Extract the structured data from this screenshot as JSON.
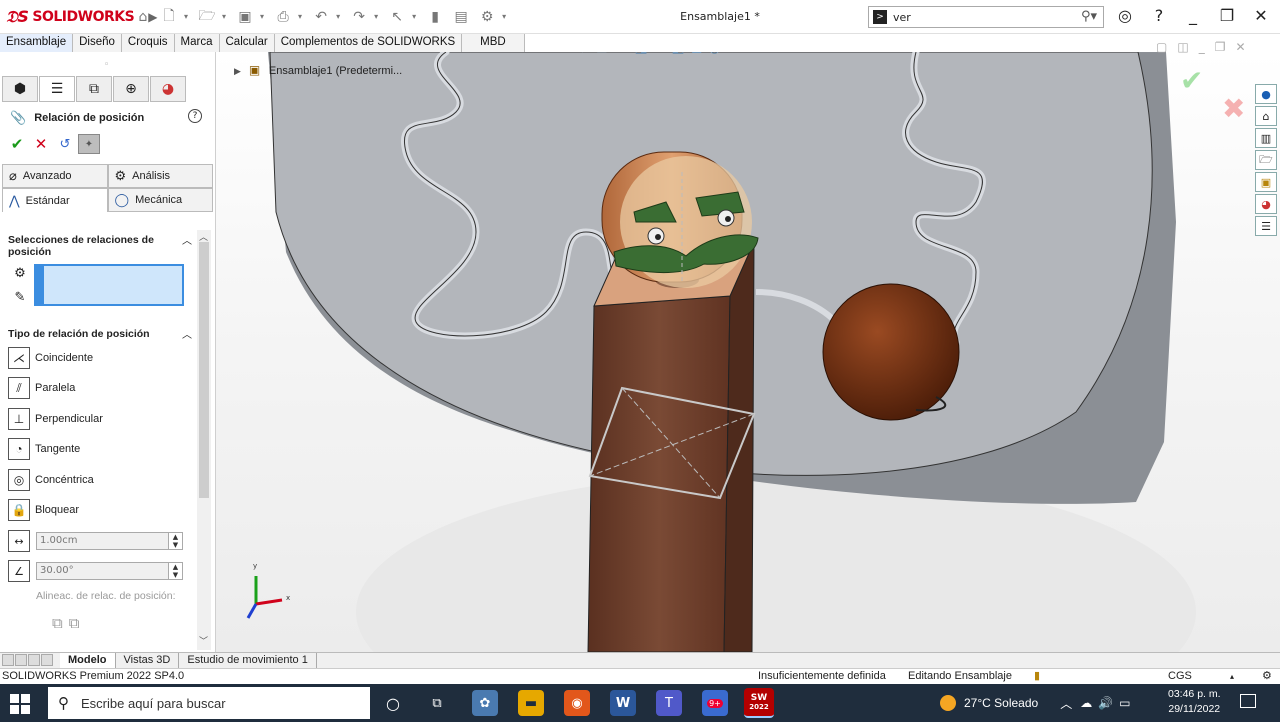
{
  "titlebar": {
    "brand": "SOLIDWORKS",
    "document_title": "Ensamblaje1 *",
    "search_value": "ver",
    "icons": [
      "home-icon",
      "new-icon",
      "open-icon",
      "save-icon",
      "print-icon",
      "undo-icon",
      "redo-icon",
      "select-icon",
      "rebuild-icon",
      "options-icon",
      "gear-icon"
    ]
  },
  "command_tabs": [
    "Ensamblaje",
    "Diseño",
    "Croquis",
    "Marca",
    "Calcular",
    "Complementos de SOLIDWORKS",
    "MBD"
  ],
  "tree": {
    "root_label": "Ensamblaje1 (Predetermi..."
  },
  "property_manager": {
    "title": "Relación de posición",
    "tabs": {
      "advanced": "Avanzado",
      "analysis": "Análisis",
      "standard": "Estándar",
      "mechanical": "Mecánica"
    },
    "selections_heading": "Selecciones de relaciones de posición",
    "type_heading": "Tipo de relación de posición",
    "mate_types": [
      "Coincidente",
      "Paralela",
      "Perpendicular",
      "Tangente",
      "Concéntrica",
      "Bloquear"
    ],
    "distance_value": "1.00cm",
    "angle_value": "30.00°",
    "alignment_label": "Alineac. de relac. de posición:"
  },
  "bottom_tabs": [
    "Modelo",
    "Vistas 3D",
    "Estudio de movimiento 1"
  ],
  "status": {
    "product": "SOLIDWORKS Premium 2022 SP4.0",
    "definition": "Insuficientemente definida",
    "mode": "Editando Ensamblaje",
    "units": "CGS"
  },
  "taskbar": {
    "search_placeholder": "Escribe aquí para buscar",
    "weather": "27°C  Soleado",
    "time": "03:46 p. m.",
    "date": "29/11/2022",
    "badge": "9+",
    "sw_year": "2022"
  },
  "triad": {
    "x": "x",
    "y": "y"
  },
  "colors": {
    "accent": "#3b8de0",
    "brand": "#d0021b",
    "taskbar": "#1f2d3d"
  }
}
